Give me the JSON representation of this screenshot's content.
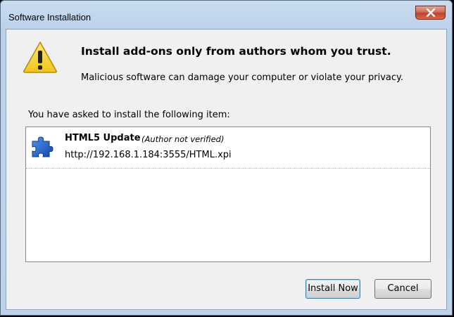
{
  "window": {
    "title": "Software Installation"
  },
  "warning": {
    "headline": "Install add-ons only from authors whom you trust.",
    "message": "Malicious software can damage your computer or violate your privacy."
  },
  "install_list": {
    "label": "You have asked to install the following item:",
    "items": [
      {
        "name": "HTML5 Update",
        "author": "(Author not verified)",
        "url": "http://192.168.1.184:3555/HTML.xpi",
        "icon": "puzzle-piece-icon"
      }
    ]
  },
  "buttons": {
    "install": "Install Now",
    "cancel": "Cancel"
  },
  "colors": {
    "warning_yellow": "#f5d21f",
    "addon_blue": "#1e5fc9",
    "close_red": "#c1402a"
  }
}
